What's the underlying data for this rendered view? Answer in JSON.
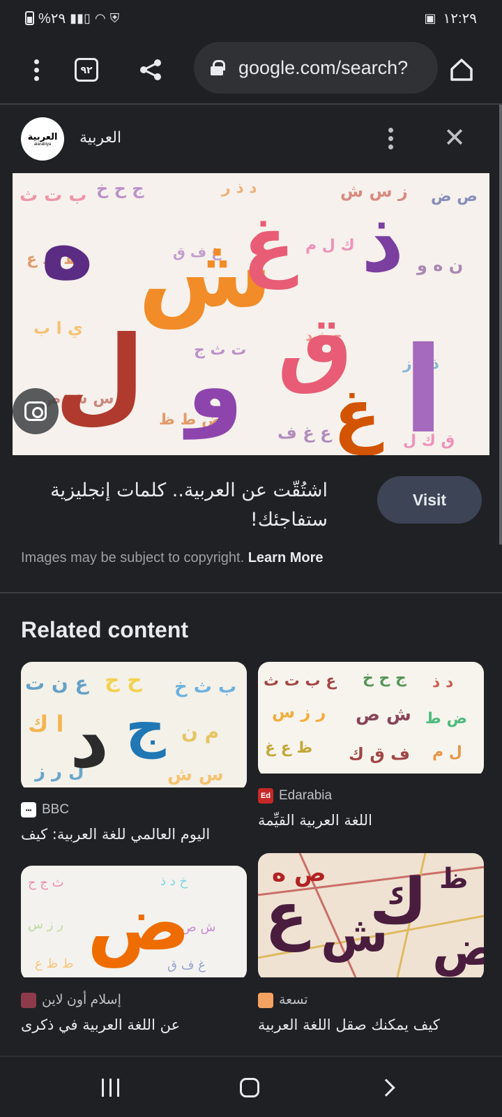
{
  "status_bar": {
    "battery_percent": "%٢٩",
    "time": "١٢:٢٩",
    "signal": "signal-icon",
    "wifi": "wifi-icon",
    "gallery": "image-icon"
  },
  "toolbar": {
    "tab_count": "٩٢",
    "url": "google.com/search?",
    "menu_icon": "more-vert-icon",
    "share_icon": "share-icon",
    "home_icon": "home-icon"
  },
  "source": {
    "logo_text": "العربية",
    "logo_sub": "alarabiya",
    "name": "العربية"
  },
  "result": {
    "title": "اشتُقّت عن العربية.. كلمات إنجليزية ستفاجئك!",
    "visit_label": "Visit",
    "copyright_text": "Images may be subject to copyright.",
    "learn_more": "Learn More"
  },
  "related": {
    "heading": "Related content",
    "cards": [
      {
        "source": "BBC",
        "caption": "اليوم العالمي للغة العربية: كيف",
        "favicon": "BBC",
        "color": "#ffffff"
      },
      {
        "source": "Edarabia",
        "caption": "اللغة العربية القيِّمة",
        "favicon": "Ed",
        "color": "#c62828"
      },
      {
        "source": "إسلام أون لاين",
        "caption": "عن اللغة العربية في ذكرى",
        "favicon": "",
        "color": "#8d3b4a"
      },
      {
        "source": "تسعة",
        "caption": "كيف يمكنك صقل اللغة العربية",
        "favicon": "",
        "color": "#f4a261"
      }
    ]
  },
  "colors": {
    "background": "#202124",
    "accent_button": "#3c4456"
  }
}
